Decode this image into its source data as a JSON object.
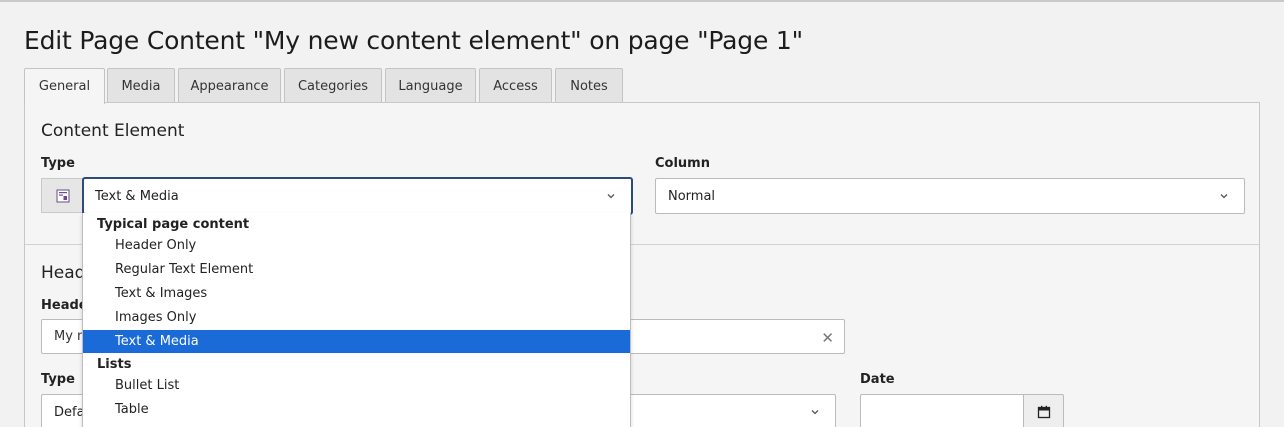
{
  "page_title": "Edit Page Content \"My new content element\" on page \"Page 1\"",
  "tabs": [
    {
      "label": "General",
      "active": true
    },
    {
      "label": "Media"
    },
    {
      "label": "Appearance"
    },
    {
      "label": "Categories"
    },
    {
      "label": "Language"
    },
    {
      "label": "Access"
    },
    {
      "label": "Notes"
    }
  ],
  "content_element": {
    "section_title": "Content Element",
    "type_label": "Type",
    "type_value": "Text & Media",
    "type_icon": "content-textmedia-icon",
    "column_label": "Column",
    "column_value": "Normal"
  },
  "header_section": {
    "section_title": "Head",
    "header_label": "Heade",
    "header_value": "My n",
    "type_label": "Type",
    "type_value": "Defa",
    "date_label": "Date",
    "date_value": ""
  },
  "dropdown": {
    "groups": [
      {
        "label": "Typical page content",
        "options": [
          "Header Only",
          "Regular Text Element",
          "Text & Images",
          "Images Only",
          "Text & Media"
        ]
      },
      {
        "label": "Lists",
        "options": [
          "Bullet List",
          "Table"
        ]
      }
    ],
    "selected": "Text & Media"
  },
  "colors": {
    "focus_border": "#2a4b7c",
    "selected_option_bg": "#1a6ad8",
    "panel_bg": "#f5f5f5"
  }
}
